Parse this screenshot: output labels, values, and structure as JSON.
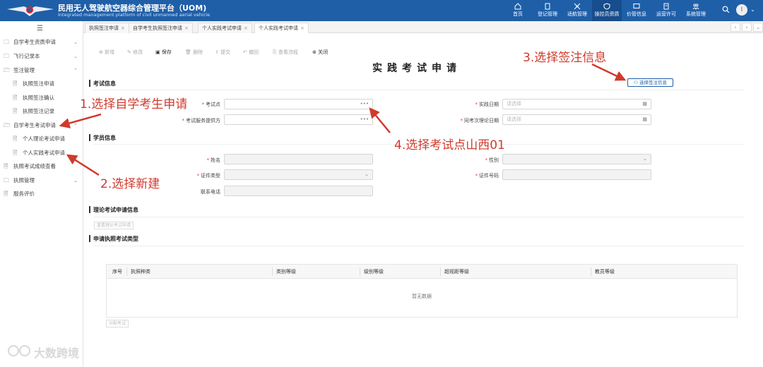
{
  "header": {
    "title": "民用无人驾驶航空器综合管理平台（UOM)",
    "subtitle": "Integrated management platform of civil unmanned aerial vehicle",
    "nav": [
      "首页",
      "登记管理",
      "适航管理",
      "操控员资质",
      "价管信息",
      "运营许可",
      "系统管理"
    ],
    "active_nav": "操控员资质",
    "user_initial": "I"
  },
  "sidebar": {
    "items": [
      {
        "label": "自学考生资质申请",
        "chevron": "⌄"
      },
      {
        "label": "飞行记录本",
        "chevron": "⌄"
      },
      {
        "label": "签注管理",
        "chevron": "⌃"
      },
      {
        "label": "执照签注申请"
      },
      {
        "label": "执照签注确认"
      },
      {
        "label": "执照签注记录"
      },
      {
        "label": "自学考生考试申请",
        "chevron": "⌃"
      },
      {
        "label": "个人理论考试申请"
      },
      {
        "label": "个人实践考试申请"
      },
      {
        "label": "执照考试成绩查看"
      },
      {
        "label": "执照管理",
        "chevron": "⌄"
      },
      {
        "label": "服务评价"
      }
    ]
  },
  "tabs": [
    "执照签注申请",
    "自学考生执照签注申请",
    "个人实践考试申请",
    "个人实践考试申请"
  ],
  "toolbar": [
    "新增",
    "修改",
    "保存",
    "删除",
    "提交",
    "撤回",
    "查看流程",
    "关闭"
  ],
  "page_title": "实践考试申请",
  "sections": {
    "exam_info": "考试信息",
    "student_info": "学员信息",
    "theory_info": "理论考试申请信息",
    "license_type": "申请执照考试类型"
  },
  "buttons": {
    "select_endorsement": "选择签注信息",
    "theory_btn": "重置理论考试申请",
    "assign_exam": "分配考试"
  },
  "fields": {
    "exam_point": "考试点",
    "provider": "考试服务提供方",
    "practice_date": "实践日期",
    "theory_date": "同考次理论日期",
    "placeholder_select": "请选择",
    "name": "姓名",
    "gender": "性别",
    "id_type": "证件类型",
    "id_number": "证件号码",
    "phone": "联系电话"
  },
  "table": {
    "columns": [
      "序号",
      "执照种类",
      "类别等级",
      "级别等级",
      "超视距等级",
      "教员等级"
    ],
    "empty_text": "暂无数据"
  },
  "annotations": {
    "step1": "1.选择自学考生申请",
    "step2": "2.选择新建",
    "step3": "3.选择签注信息",
    "step4": "4.选择考试点山西01"
  },
  "watermark": "大数跨境",
  "colors": {
    "header": "#1f5fa8",
    "annotation": "#d03a2d"
  }
}
